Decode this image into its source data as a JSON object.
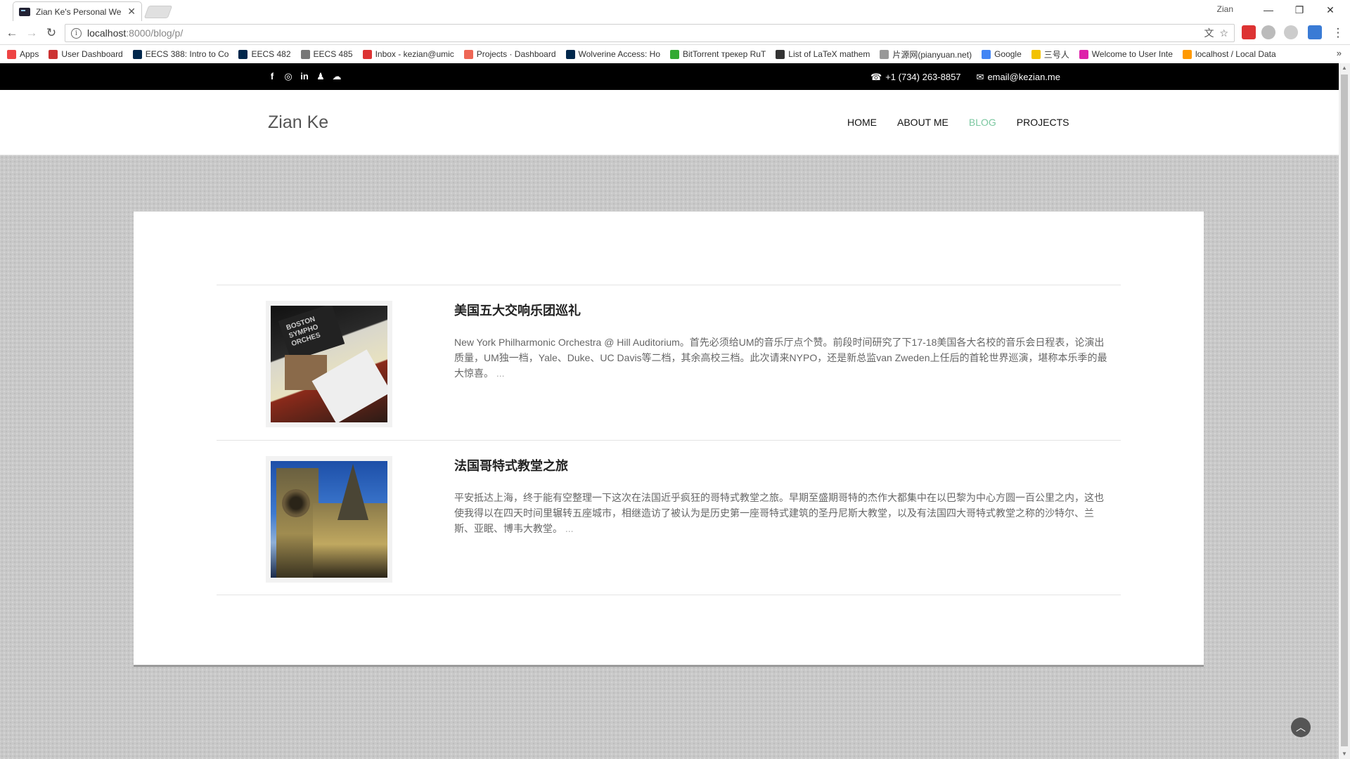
{
  "browser": {
    "tab_title": "Zian Ke's Personal Website",
    "user": "Zian",
    "url_host": "localhost",
    "url_rest": ":8000/blog/p/",
    "bookmarks": [
      {
        "label": "Apps",
        "icon": "apps-grid-icon",
        "color": "#e44"
      },
      {
        "label": "User Dashboard",
        "icon": "dashboard-icon",
        "color": "#c33"
      },
      {
        "label": "EECS 388: Intro to Co",
        "icon": "umich-m-icon",
        "color": "#00274c"
      },
      {
        "label": "EECS 482",
        "icon": "umich-m-icon",
        "color": "#00274c"
      },
      {
        "label": "EECS 485",
        "icon": "eecs-icon",
        "color": "#777"
      },
      {
        "label": "Inbox - kezian@umic",
        "icon": "gmail-icon",
        "color": "#d33"
      },
      {
        "label": "Projects · Dashboard",
        "icon": "gitlab-icon",
        "color": "#e65"
      },
      {
        "label": "Wolverine Access: Ho",
        "icon": "umich-m-icon",
        "color": "#00274c"
      },
      {
        "label": "BitTorrent трекер RuT",
        "icon": "rutracker-icon",
        "color": "#3a3"
      },
      {
        "label": "List of LaTeX mathem",
        "icon": "tex-icon",
        "color": "#333"
      },
      {
        "label": "片源网(pianyuan.net)",
        "icon": "page-icon",
        "color": "#999"
      },
      {
        "label": "Google",
        "icon": "google-icon",
        "color": "#4285f4"
      },
      {
        "label": "三号人",
        "icon": "folder-icon",
        "color": "#f2c200"
      },
      {
        "label": "Welcome to User Inte",
        "icon": "site-icon",
        "color": "#d2a"
      },
      {
        "label": "localhost / Local Data",
        "icon": "phpmyadmin-icon",
        "color": "#f90"
      }
    ]
  },
  "site": {
    "phone": "+1 (734) 263-8857",
    "email": "email@kezian.me",
    "brand": "Zian Ke",
    "menu": [
      "HOME",
      "ABOUT ME",
      "BLOG",
      "PROJECTS"
    ],
    "active_menu": "BLOG",
    "social_icons": [
      "facebook-icon",
      "github-icon",
      "linkedin-icon",
      "qq-icon",
      "wechat-icon"
    ]
  },
  "posts": [
    {
      "title": "美国五大交响乐团巡礼",
      "excerpt": "New York Philharmonic Orchestra @ Hill Auditorium。首先必须给UM的音乐厅点个赞。前段时间研究了下17-18美国各大名校的音乐会日程表，论演出质量，UM独一档，Yale、Duke、UC Davis等二档，其余高校三档。此次请来NYPO，还是新总监van Zweden上任后的首轮世界巡演，堪称本乐季的最大惊喜。",
      "more": "...",
      "image_text": "BOSTON SYMPHO ORCHES"
    },
    {
      "title": "法国哥特式教堂之旅",
      "excerpt": "平安抵达上海，终于能有空整理一下这次在法国近乎疯狂的哥特式教堂之旅。早期至盛期哥特的杰作大都集中在以巴黎为中心方圆一百公里之内，这也使我得以在四天时间里辗转五座城市，相继造访了被认为是历史第一座哥特式建筑的圣丹尼斯大教堂，以及有法国四大哥特式教堂之称的沙特尔、兰斯、亚眠、博韦大教堂。",
      "more": "..."
    }
  ]
}
